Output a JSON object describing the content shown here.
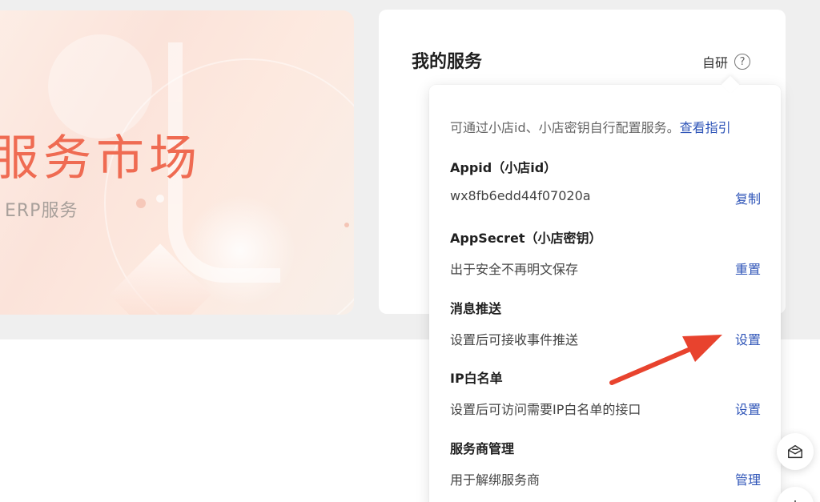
{
  "banner": {
    "title": "服务市场",
    "subtitle": "· ERP服务"
  },
  "service_card": {
    "title": "我的服务",
    "mode_label": "自研",
    "help_symbol": "?"
  },
  "popover": {
    "intro": "可通过小店id、小店密钥自行配置服务。",
    "guide_link": "查看指引",
    "rows": [
      {
        "label": "Appid（小店id）",
        "value": "wx8fb6edd44f07020a",
        "action": "复制"
      },
      {
        "label": "AppSecret（小店密钥）",
        "value": "出于安全不再明文保存",
        "action": "重置"
      },
      {
        "label": "消息推送",
        "value": "设置后可接收事件推送",
        "action": "设置"
      },
      {
        "label": "IP白名单",
        "value": "设置后可访问需要IP白名单的接口",
        "action": "设置"
      },
      {
        "label": "服务商管理",
        "value": "用于解绑服务商",
        "action": "管理"
      }
    ]
  },
  "colors": {
    "link": "#2f55b8",
    "banner_title": "#ef6b52",
    "annotation_arrow": "#e8432e"
  },
  "icons": {
    "float_button_1": "mail-icon",
    "float_button_2": "plus-icon"
  }
}
